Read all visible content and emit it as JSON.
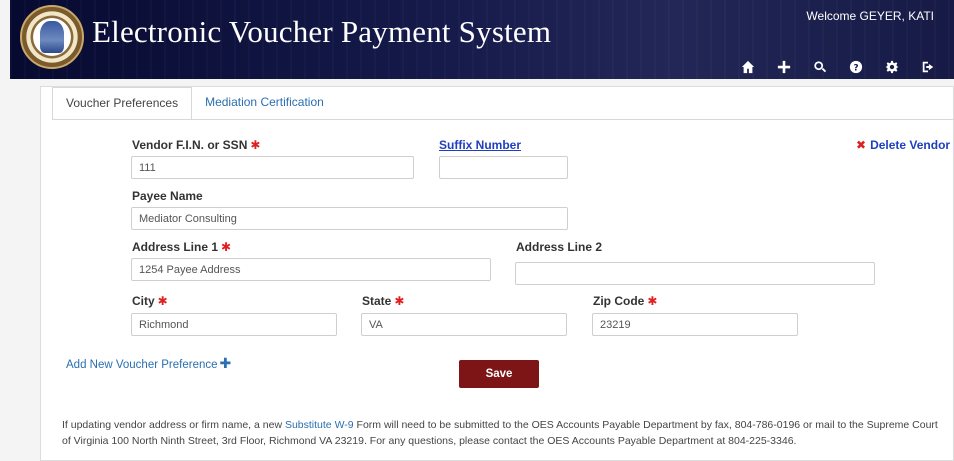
{
  "header": {
    "title": "Electronic Voucher Payment System",
    "welcome": "Welcome GEYER, KATI",
    "icons": [
      "home-icon",
      "plus-icon",
      "search-icon",
      "help-icon",
      "gear-icon",
      "logout-icon"
    ]
  },
  "tabs": [
    {
      "label": "Voucher Preferences",
      "active": true
    },
    {
      "label": "Mediation Certification",
      "active": false
    }
  ],
  "form": {
    "vendor_fin_label": "Vendor F.I.N. or SSN",
    "vendor_fin_value": "111",
    "suffix_label": "Suffix Number",
    "suffix_value": "",
    "delete_label": "Delete Vendor",
    "payee_label": "Payee Name",
    "payee_value": "Mediator Consulting",
    "address1_label": "Address Line 1",
    "address1_value": "1254 Payee Address",
    "address2_label": "Address Line 2",
    "address2_value": "",
    "city_label": "City",
    "city_value": "Richmond",
    "state_label": "State",
    "state_value": "VA",
    "zip_label": "Zip Code",
    "zip_value": "23219",
    "required_marker": "✱"
  },
  "actions": {
    "add_new_label": "Add New Voucher Preference",
    "save_label": "Save"
  },
  "note": {
    "before_link": "If updating vendor address or firm name, a new ",
    "link": "Substitute W-9",
    "after_link": " Form will need to be submitted to the OES Accounts Payable Department by fax, 804-786-0196 or mail to the Supreme Court of Virginia 100 North Ninth Street, 3rd Floor, Richmond VA 23219. For any questions, please contact the OES Accounts Payable Department at 804-225-3346."
  },
  "colors": {
    "header_bg": "#151a4a",
    "save_bg": "#7d1416",
    "link": "#2a6fb0",
    "required": "#e02020"
  }
}
